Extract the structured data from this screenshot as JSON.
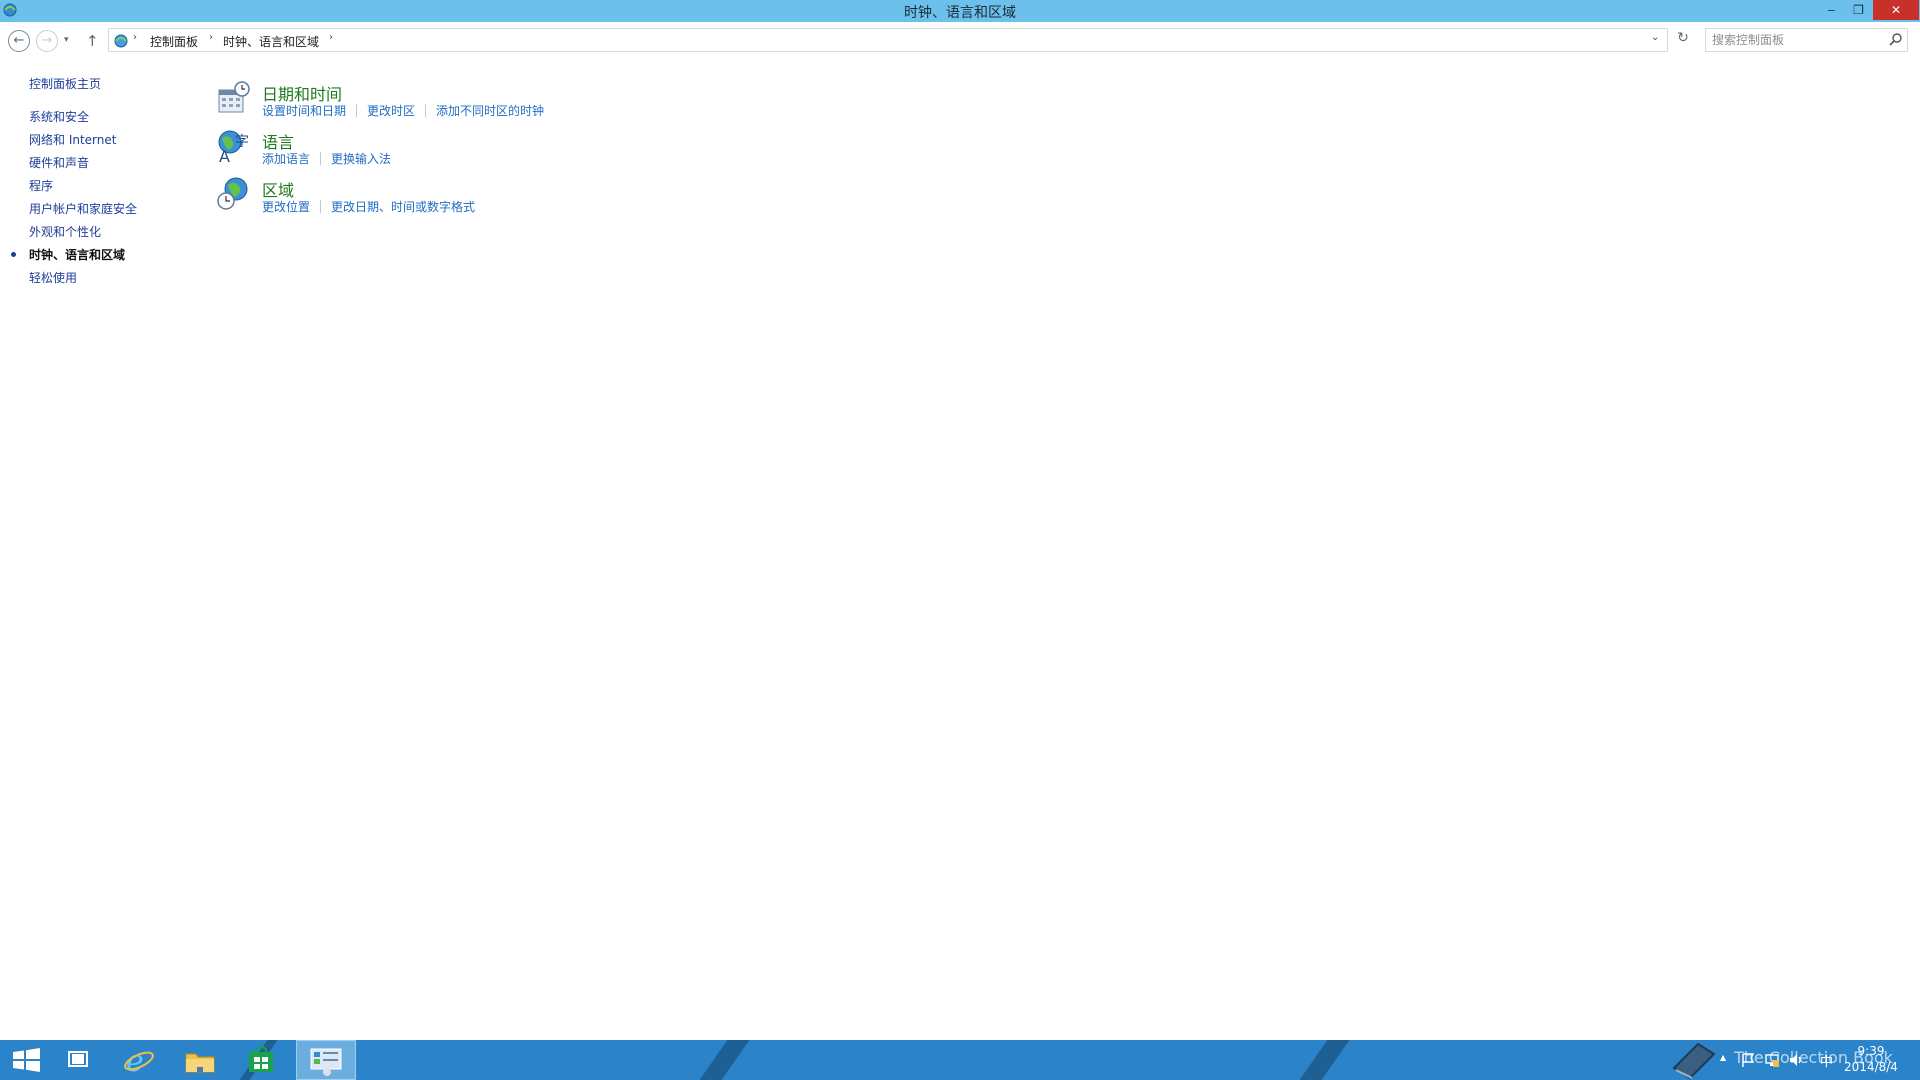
{
  "window": {
    "title": "时钟、语言和区域",
    "minimize_glyph": "‒",
    "restore_glyph": "❐",
    "close_glyph": "✕"
  },
  "navbar": {
    "back_glyph": "←",
    "forward_glyph": "→",
    "recent_glyph": "▾",
    "up_glyph": "↑",
    "breadcrumbs": [
      "控制面板",
      "时钟、语言和区域"
    ],
    "breadcrumb_sep": "›",
    "address_dropdown_glyph": "⌄",
    "refresh_glyph": "↻",
    "search_placeholder": "搜索控制面板"
  },
  "leftnav": {
    "items": [
      {
        "label": "控制面板主页"
      },
      {
        "label": "系统和安全"
      },
      {
        "label": "网络和 Internet"
      },
      {
        "label": "硬件和声音"
      },
      {
        "label": "程序"
      },
      {
        "label": "用户帐户和家庭安全"
      },
      {
        "label": "外观和个性化"
      },
      {
        "label": "时钟、语言和区域",
        "current": true
      },
      {
        "label": "轻松使用"
      }
    ]
  },
  "categories": [
    {
      "title": "日期和时间",
      "icon": "calendar-clock-icon",
      "links": [
        "设置时间和日期",
        "更改时区",
        "添加不同时区的时钟"
      ]
    },
    {
      "title": "语言",
      "icon": "language-globe-icon",
      "links": [
        "添加语言",
        "更换输入法"
      ]
    },
    {
      "title": "区域",
      "icon": "region-globe-clock-icon",
      "links": [
        "更改位置",
        "更改日期、时间或数字格式"
      ]
    }
  ],
  "taskbar": {
    "pinned": [
      "start-icon",
      "task-view-icon",
      "internet-explorer-icon",
      "file-explorer-icon",
      "store-icon",
      "control-panel-icon"
    ],
    "tray": {
      "show_hidden_glyph": "▲",
      "ime_label": "中",
      "time": "9:39",
      "date": "2014/8/4"
    },
    "watermark": "The Collection Book"
  },
  "colors": {
    "titlebar": "#6cc0ec",
    "taskbar": "#2b83c9",
    "link_blue": "#1f6cc4",
    "category_green": "#1d7a1d",
    "close_red": "#c7312a"
  }
}
